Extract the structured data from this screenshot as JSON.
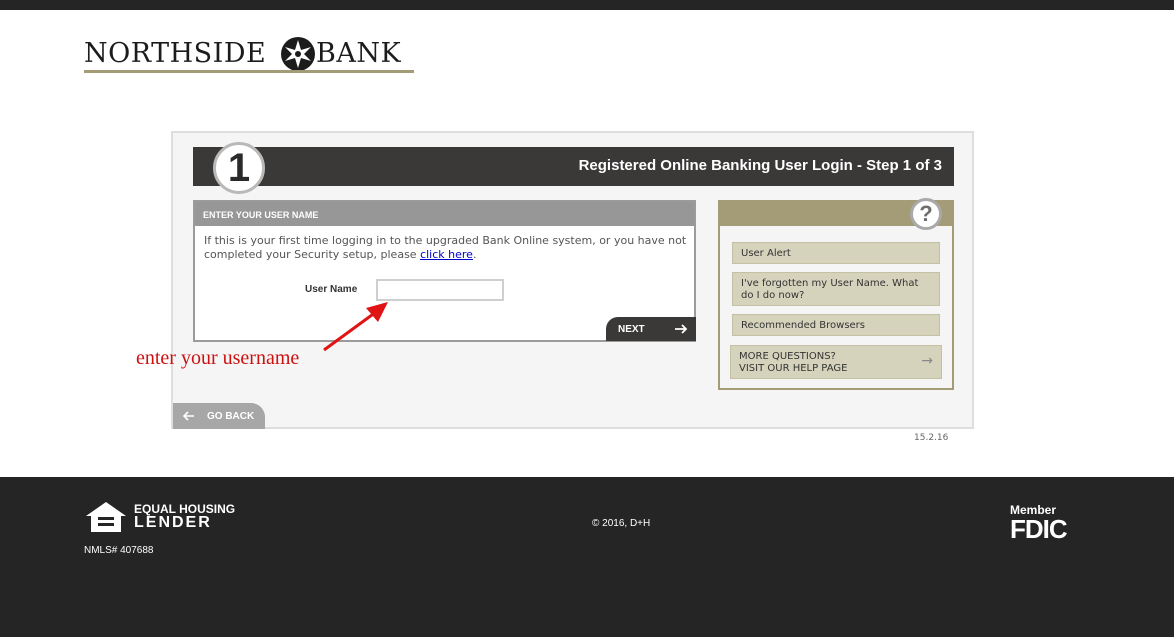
{
  "logo": {
    "left_text": "NORTHSIDE",
    "right_text": "BANK"
  },
  "step": {
    "number": "1",
    "title": "Registered Online Banking User Login - Step 1 of 3"
  },
  "username_section": {
    "heading": "ENTER YOUR USER NAME",
    "info_text": "If this is your first time logging in to the upgraded Bank Online system, or you have not completed your Security setup, please",
    "link_text": "click here",
    "info_end": ".",
    "field_label": "User Name",
    "field_value": "",
    "next_label": "NEXT"
  },
  "help": {
    "icon": "?",
    "items": [
      {
        "label": "User Alert"
      },
      {
        "label": "I've forgotten my User Name. What do I do now?"
      },
      {
        "label": "Recommended Browsers"
      }
    ],
    "more_line1": "MORE QUESTIONS?",
    "more_line2": "VISIT OUR HELP PAGE"
  },
  "go_back_label": "GO BACK",
  "version": "15.2.16",
  "annotation": "enter your username",
  "footer": {
    "eho_line1": "EQUAL HOUSING",
    "eho_line2": "LENDER",
    "nmls": "NMLS# 407688",
    "copyright": "© 2016, D+H",
    "fdic_member": "Member",
    "fdic_name": "FDIC"
  },
  "colors": {
    "dark": "#3b3838",
    "accent": "#a39c76",
    "link": "#0000cc",
    "annotation": "#cc1111"
  },
  "icons": {
    "next": "arrow-right-icon",
    "back": "arrow-left-icon",
    "help": "question-mark-icon",
    "logo": "star-burst-icon",
    "eho": "equal-housing-house-icon"
  }
}
